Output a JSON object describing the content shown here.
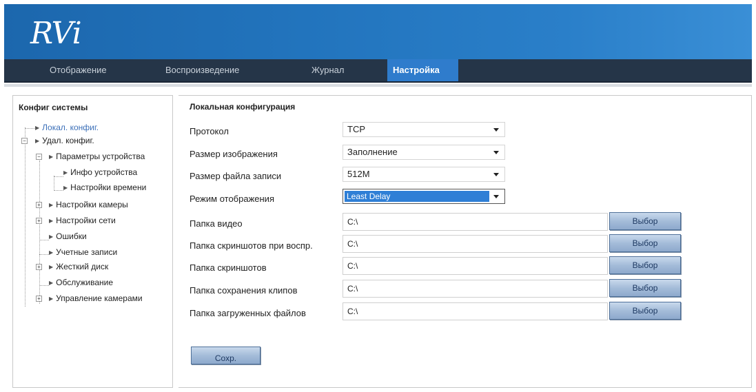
{
  "brand": {
    "logo": "RVi"
  },
  "nav": {
    "items": [
      {
        "label": "Отображение"
      },
      {
        "label": "Воспроизведение"
      },
      {
        "label": "Журнал"
      },
      {
        "label": "Настройка"
      }
    ],
    "active": "Настройка"
  },
  "sidebar": {
    "title": "Конфиг системы",
    "items": [
      {
        "label": "Локал. конфиг.",
        "selected": true
      },
      {
        "label": "Удал. конфиг."
      },
      {
        "label": "Параметры устройства"
      },
      {
        "label": "Инфо устройства"
      },
      {
        "label": "Настройки времени"
      },
      {
        "label": "Настройки камеры"
      },
      {
        "label": "Настройки сети"
      },
      {
        "label": "Ошибки"
      },
      {
        "label": "Учетные записи"
      },
      {
        "label": "Жесткий диск"
      },
      {
        "label": "Обслуживание"
      },
      {
        "label": "Управление камерами"
      }
    ]
  },
  "main": {
    "title": "Локальная конфигурация",
    "fields": [
      {
        "label": "Протокол",
        "value": "TCP"
      },
      {
        "label": "Размер изображения",
        "value": "Заполнение"
      },
      {
        "label": "Размер файла записи",
        "value": "512M"
      },
      {
        "label": "Режим отображения",
        "value": "Least Delay"
      }
    ],
    "paths": [
      {
        "label": "Папка видео",
        "value": "C:\\",
        "button": "Выбор"
      },
      {
        "label": "Папка скриншотов при воспр.",
        "value": "C:\\",
        "button": "Выбор"
      },
      {
        "label": "Папка скриншотов",
        "value": "C:\\",
        "button": "Выбор"
      },
      {
        "label": "Папка сохранения клипов",
        "value": "C:\\",
        "button": "Выбор"
      },
      {
        "label": "Папка загруженных файлов",
        "value": "C:\\",
        "button": "Выбор"
      }
    ],
    "save_label": "Сохр."
  },
  "colors": {
    "banner": "#2274bd",
    "nav_bg": "#253548",
    "nav_active": "#2f7ccc",
    "selection": "#2f7fd6",
    "sidebar_selected": "#3b6fb8"
  }
}
